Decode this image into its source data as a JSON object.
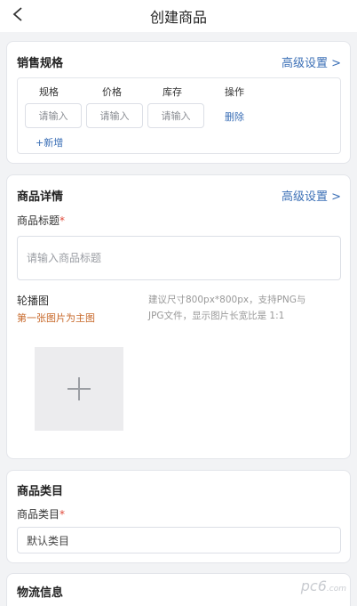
{
  "header": {
    "title": "创建商品"
  },
  "sales_spec": {
    "title": "销售规格",
    "advanced_label": "高级设置 >",
    "columns": [
      "规格",
      "价格",
      "库存",
      "操作"
    ],
    "placeholders": [
      "请输入",
      "请输入",
      "请输入"
    ],
    "delete_label": "删除",
    "add_label": "+新增"
  },
  "details": {
    "title": "商品详情",
    "advanced_label": "高级设置 >",
    "product_title_label": "商品标题",
    "required_mark": "*",
    "product_title_placeholder": "请输入商品标题",
    "carousel_label": "轮播图",
    "carousel_hint_primary": "第一张图片为主图",
    "carousel_hint_line1": "建议尺寸800px*800px，支持PNG与",
    "carousel_hint_line2": "JPG文件，显示图片长宽比是 1:1"
  },
  "category": {
    "title": "商品类目",
    "field_label": "商品类目",
    "required_mark": "*",
    "value": "默认类目"
  },
  "logistics": {
    "title": "物流信息"
  },
  "watermark": {
    "text": "pc6",
    "suffix": ".com"
  },
  "colors": {
    "accent": "#3b6fb6",
    "required": "#e04a3a",
    "hint": "#c86a2c"
  }
}
